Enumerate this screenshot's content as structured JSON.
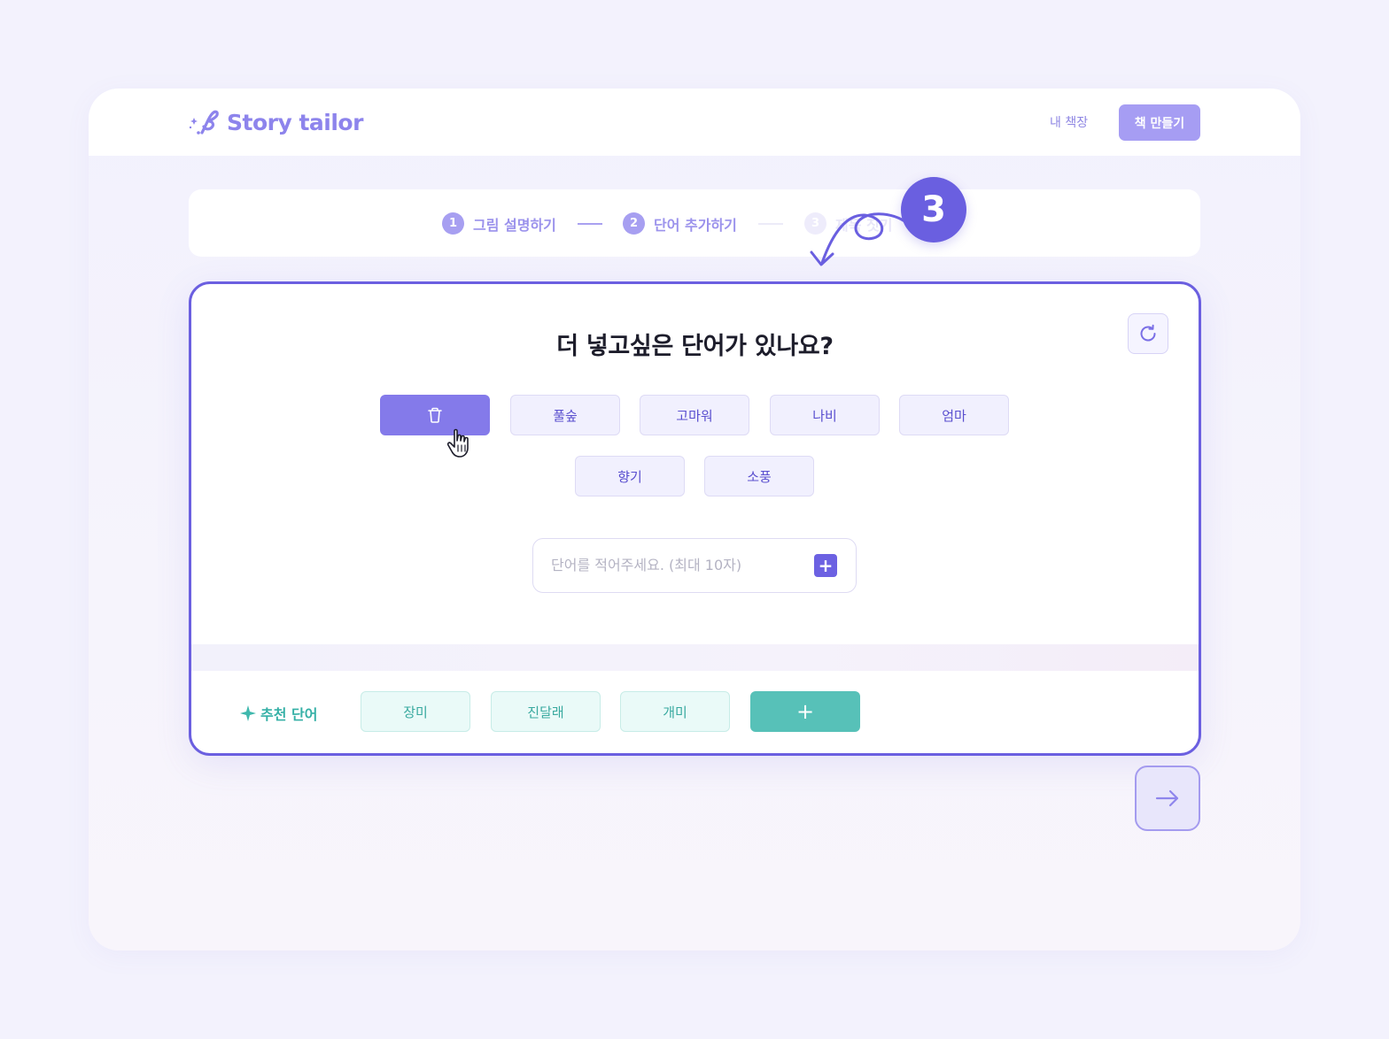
{
  "brand": {
    "name": "Story tailor",
    "accent": "#6b5fe0",
    "secondary": "#57c1b8"
  },
  "header": {
    "nav_link": "내 책장",
    "cta": "책 만들기"
  },
  "stepper": {
    "steps": [
      {
        "num": "1",
        "label": "그림 설명하기",
        "state": "done"
      },
      {
        "num": "2",
        "label": "단어 추가하기",
        "state": "current"
      },
      {
        "num": "3",
        "label": "제목 짓기",
        "state": "upcoming"
      }
    ]
  },
  "card": {
    "title": "더 넣고싶은 단어가 있나요?",
    "chips": [
      "",
      "풀숲",
      "고마워",
      "나비",
      "엄마",
      "향기",
      "소풍"
    ],
    "input": {
      "placeholder": "단어를 적어주세요. (최대 10자)",
      "value": ""
    },
    "add_symbol": "+",
    "recommended": {
      "label": "추천 단어",
      "words": [
        "장미",
        "진달래",
        "개미"
      ],
      "add_symbol": "+"
    }
  },
  "callout": {
    "number": "3"
  },
  "icons": {
    "logo": "pen-sparkle-icon",
    "refresh": "refresh-icon",
    "delete": "trash-icon",
    "next": "arrow-right-icon",
    "sparkle": "sparkle-icon",
    "pointer": "hand-cursor-icon"
  }
}
